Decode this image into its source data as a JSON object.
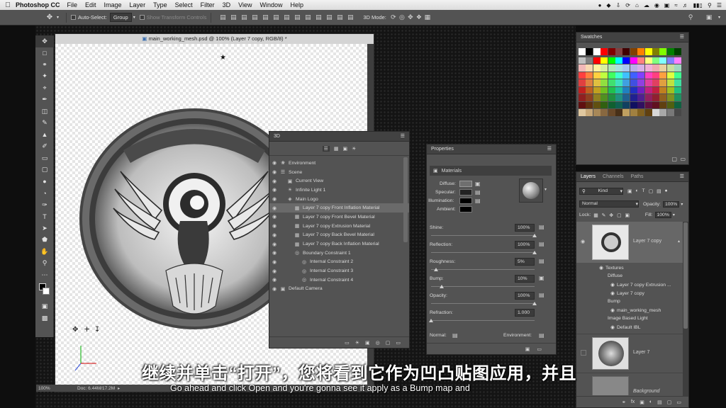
{
  "menubar": {
    "app": "Photoshop CC",
    "items": [
      "File",
      "Edit",
      "Image",
      "Layer",
      "Type",
      "Select",
      "Filter",
      "3D",
      "View",
      "Window",
      "Help"
    ]
  },
  "optbar": {
    "auto_select": "Auto-Select:",
    "group": "Group",
    "show_transform": "Show Transform Controls",
    "mode3d": "3D Mode:"
  },
  "document": {
    "title": "main_working_mesh.psd @ 100% (Layer 7 copy, RGB/8) *",
    "zoom": "100%",
    "doc_size": "Doc: 6.44M/17.2M"
  },
  "panel3d": {
    "tab": "3D",
    "rows": [
      {
        "label": "Environment",
        "indent": 0,
        "icon": "environment-icon",
        "sel": false
      },
      {
        "label": "Scene",
        "indent": 0,
        "icon": "scene-icon",
        "sel": false
      },
      {
        "label": "Current View",
        "indent": 1,
        "icon": "camera-icon",
        "sel": false
      },
      {
        "label": "Infinite Light 1",
        "indent": 1,
        "icon": "light-icon",
        "sel": false
      },
      {
        "label": "Main Logo",
        "indent": 1,
        "icon": "mesh-icon",
        "sel": false
      },
      {
        "label": "Layer 7 copy Front Inflation Material",
        "indent": 2,
        "icon": "material-icon",
        "sel": true
      },
      {
        "label": "Layer 7 copy Front Bevel Material",
        "indent": 2,
        "icon": "material-icon",
        "sel": false
      },
      {
        "label": "Layer 7 copy Extrusion Material",
        "indent": 2,
        "icon": "material-icon",
        "sel": false
      },
      {
        "label": "Layer 7 copy Back Bevel Material",
        "indent": 2,
        "icon": "material-icon",
        "sel": false
      },
      {
        "label": "Layer 7 copy Back Inflation Material",
        "indent": 2,
        "icon": "material-icon",
        "sel": false
      },
      {
        "label": "Boundary Constraint 1",
        "indent": 2,
        "icon": "constraint-icon",
        "sel": false
      },
      {
        "label": "Internal Constraint 2",
        "indent": 3,
        "icon": "constraint-icon",
        "sel": false
      },
      {
        "label": "Internal Constraint 3",
        "indent": 3,
        "icon": "constraint-icon",
        "sel": false
      },
      {
        "label": "Internal Constraint 4",
        "indent": 3,
        "icon": "constraint-icon",
        "sel": false
      },
      {
        "label": "Default Camera",
        "indent": 0,
        "icon": "camera-icon",
        "sel": false
      }
    ]
  },
  "properties": {
    "tab": "Properties",
    "section": "Materials",
    "diffuse": "Diffuse:",
    "specular": "Specular:",
    "illumination": "Illumination:",
    "ambient": "Ambient:",
    "shine_label": "Shine:",
    "shine": "100%",
    "reflection_label": "Reflection:",
    "reflection": "100%",
    "roughness_label": "Roughness:",
    "roughness": "5%",
    "bump_label": "Bump:",
    "bump": "10%",
    "opacity_label": "Opacity:",
    "opacity": "100%",
    "refraction_label": "Refraction:",
    "refraction": "1.000",
    "normal_label": "Normal:",
    "environment_label": "Environment:",
    "slider_levels": {
      "shine": 1.0,
      "reflection": 1.0,
      "roughness": 0.05,
      "bump": 0.1,
      "opacity": 1.0,
      "refraction": 0.0
    }
  },
  "swatches": {
    "tab": "Swatches",
    "colors": [
      "#ffffff",
      "#000000",
      "#ffffff",
      "#ff0000",
      "#800000",
      "#804040",
      "#400000",
      "#804000",
      "#ff8000",
      "#ffff00",
      "#808000",
      "#80ff00",
      "#008000",
      "#004000",
      "#c0c0c0",
      "#808080",
      "#ff0000",
      "#ffff00",
      "#00ff00",
      "#00ffff",
      "#0000ff",
      "#ff00ff",
      "#ff8080",
      "#ffff80",
      "#80ff80",
      "#80ffff",
      "#8080ff",
      "#ff80ff",
      "#f2b8b8",
      "#f8d8b0",
      "#fff2a0",
      "#d8f0a0",
      "#b0e8b8",
      "#a8e0e0",
      "#a8c8f0",
      "#b8b0e8",
      "#d8b0e8",
      "#f0b0d8",
      "#f0a8b0",
      "#e8d0a0",
      "#c8e0a0",
      "#a0d8c0",
      "#ff4040",
      "#ff8040",
      "#ffd040",
      "#c0ff40",
      "#40ff60",
      "#40ffd0",
      "#40c0ff",
      "#4060ff",
      "#8040ff",
      "#ff40c0",
      "#ff4080",
      "#ffa040",
      "#e0ff40",
      "#40ff90",
      "#e04040",
      "#e08040",
      "#e0c040",
      "#90e040",
      "#40e070",
      "#40e0c0",
      "#40a0e0",
      "#4050e0",
      "#9040e0",
      "#e040a0",
      "#e04060",
      "#e0a040",
      "#c0e040",
      "#40e0a0",
      "#c02020",
      "#c06020",
      "#c0a020",
      "#70c020",
      "#20c050",
      "#20c0a0",
      "#2080c0",
      "#2030c0",
      "#7020c0",
      "#c02080",
      "#c02040",
      "#c08020",
      "#a0c020",
      "#20c080",
      "#902020",
      "#904020",
      "#908020",
      "#509020",
      "#209040",
      "#209080",
      "#206090",
      "#202090",
      "#502090",
      "#902060",
      "#902030",
      "#906020",
      "#809020",
      "#209060",
      "#601010",
      "#603010",
      "#605010",
      "#306010",
      "#106030",
      "#106050",
      "#104060",
      "#101060",
      "#301060",
      "#601040",
      "#601020",
      "#604010",
      "#506010",
      "#106040",
      "#e0c8a0",
      "#c8a878",
      "#a88858",
      "#886840",
      "#684828",
      "#483018",
      "#c0a060",
      "#a08040",
      "#806020",
      "#604010",
      "#d8d8d8",
      "#a8a8a8",
      "#787878",
      "#484848"
    ]
  },
  "layers": {
    "tabs": [
      "Layers",
      "Channels",
      "Paths"
    ],
    "kind": "Kind",
    "blend": "Normal",
    "opacity_label": "Opacity:",
    "opacity": "100%",
    "lock_label": "Lock:",
    "fill_label": "Fill:",
    "fill": "100%",
    "layer1": "Layer 7 copy",
    "textures": "Textures",
    "diffuse": "Diffuse",
    "diffuse_item1": "Layer 7 copy Extrusion ...",
    "diffuse_item2": "Layer 7 copy",
    "bump": "Bump",
    "bump_item": "main_working_mesh",
    "ibl": "Image Based Light",
    "ibl_item": "Default IBL",
    "layer2": "Layer 7",
    "layer3": "Background"
  },
  "subtitles": {
    "cn": "继续并单击“打开”，您将看到它作为凹凸贴图应用，并且",
    "en": "Go ahead and click Open and you're gonna see it apply as a Bump map and"
  },
  "colors": {
    "panel_bg": "#535353",
    "dark_bg": "#141414",
    "selection": "#6a6a6a"
  }
}
